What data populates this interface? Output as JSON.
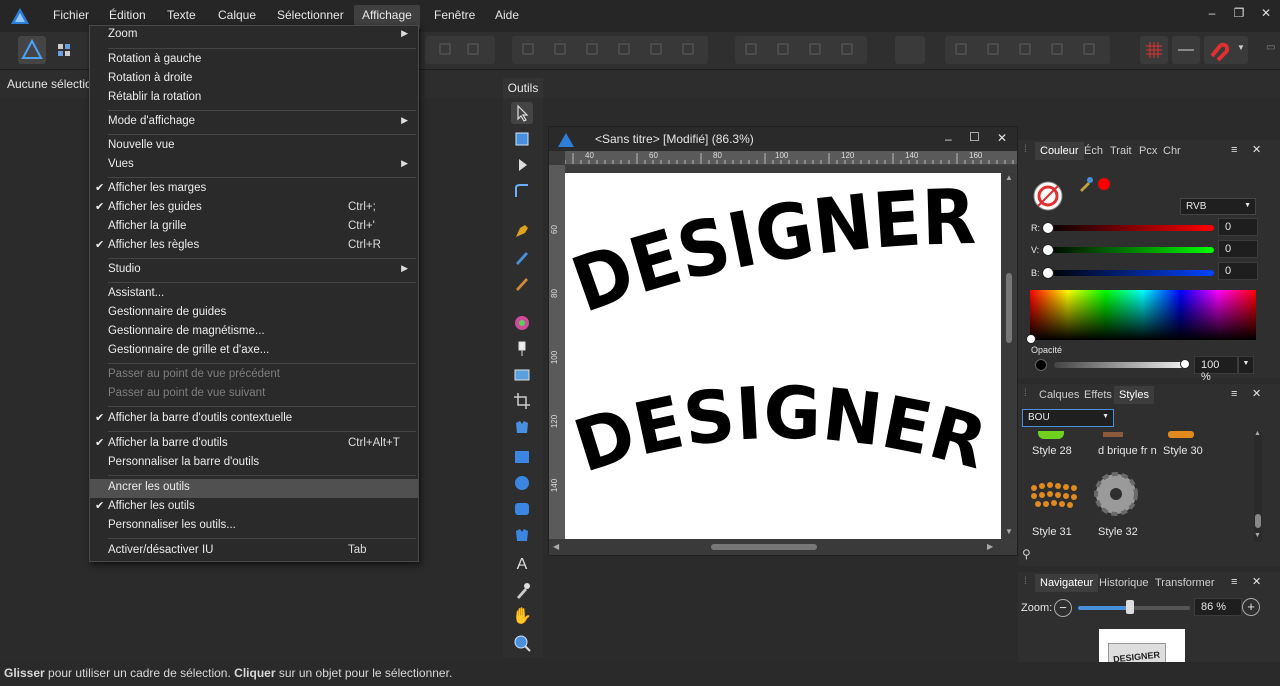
{
  "menubar": {
    "items": [
      "Fichier",
      "Édition",
      "Texte",
      "Calque",
      "Sélectionner",
      "Affichage",
      "Fenêtre",
      "Aide"
    ]
  },
  "context": {
    "text": "Aucune sélection"
  },
  "menu": {
    "zoom": "Zoom",
    "rot_left": "Rotation à gauche",
    "rot_right": "Rotation à droite",
    "reset_rot": "Rétablir la rotation",
    "view_mode": "Mode d'affichage",
    "new_view": "Nouvelle vue",
    "views": "Vues",
    "show_margins": "Afficher les marges",
    "show_guides": "Afficher les guides",
    "show_guides_sc": "Ctrl+;",
    "show_grid": "Afficher la grille",
    "show_grid_sc": "Ctrl+'",
    "show_rulers": "Afficher les règles",
    "show_rulers_sc": "Ctrl+R",
    "studio": "Studio",
    "assistant": "Assistant...",
    "guides_mgr": "Gestionnaire de guides",
    "snap_mgr": "Gestionnaire de magnétisme...",
    "grid_mgr": "Gestionnaire de grille et d'axe...",
    "prev_view": "Passer au point de vue précédent",
    "next_view": "Passer au point de vue suivant",
    "context_bar": "Afficher la barre d'outils contextuelle",
    "toolbar": "Afficher la barre d'outils",
    "toolbar_sc": "Ctrl+Alt+T",
    "custom_toolbar": "Personnaliser la barre d'outils",
    "dock_tools": "Ancrer les outils",
    "show_tools": "Afficher les outils",
    "custom_tools": "Personnaliser les outils...",
    "toggle_ui": "Activer/désactiver IU",
    "toggle_ui_sc": "Tab"
  },
  "tools": {
    "title": "Outils"
  },
  "document": {
    "title": "<Sans titre> [Modifié] (86.3%)",
    "text1": "DESIGNER",
    "text2": "DESIGNER",
    "ruler_h": [
      "40",
      "60",
      "80",
      "100",
      "120",
      "140",
      "160"
    ],
    "ruler_v": [
      "60",
      "80",
      "100",
      "120",
      "140"
    ]
  },
  "color_panel": {
    "tabs": [
      "Couleur",
      "Éch",
      "Trait",
      "Pcx",
      "Chr"
    ],
    "model": "RVB",
    "r_label": "R:",
    "r_value": "0",
    "g_label": "V:",
    "g_value": "0",
    "b_label": "B:",
    "b_value": "0",
    "opacity_label": "Opacité",
    "opacity_value": "100 %",
    "accent": "#ff0000"
  },
  "styles_panel": {
    "tabs": [
      "Calques",
      "Effets",
      "Styles"
    ],
    "category": "BOU",
    "items": [
      "Style 28",
      "d brique fr n",
      "Style 30",
      "Style 31",
      "Style 32"
    ]
  },
  "nav_panel": {
    "tabs": [
      "Navigateur",
      "Historique",
      "Transformer"
    ],
    "zoom_label": "Zoom:",
    "zoom_value": "86 %",
    "thumb_text": "DESIGNER"
  },
  "status": {
    "b1": "Glisser",
    "t1": " pour utiliser un cadre de sélection. ",
    "b2": "Cliquer",
    "t2": " sur un objet pour le sélectionner."
  }
}
